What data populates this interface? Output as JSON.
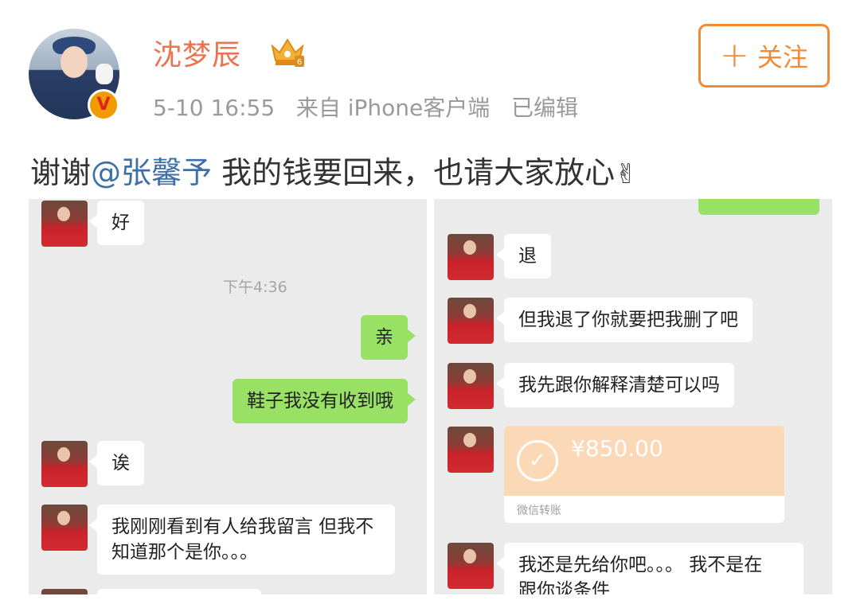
{
  "post": {
    "username": "沈梦辰",
    "date": "5-10 16:55",
    "source": "来自 iPhone客户端",
    "edited": "已编辑",
    "follow_label": "关注",
    "text_prefix": "谢谢",
    "mention": "@张馨予",
    "text_suffix": " 我的钱要回来，也请大家放心",
    "badge_icon": "verified-v-icon",
    "crown_icon": "crown-level-icon",
    "emoji_icon": "victory-hand-icon"
  },
  "chat_left": {
    "messages": [
      {
        "side": "in",
        "text": "好"
      },
      {
        "side": "time",
        "text": "下午4:36"
      },
      {
        "side": "out",
        "text": "亲"
      },
      {
        "side": "out",
        "text": "鞋子我没有收到哦"
      },
      {
        "side": "in",
        "text": "诶"
      },
      {
        "side": "in",
        "line1": "我刚刚看到有人给我留言 但我不",
        "line2": "知道那个是你。。。"
      }
    ]
  },
  "chat_right": {
    "messages": [
      {
        "side": "in",
        "text": "退"
      },
      {
        "side": "in",
        "text": "但我退了你就要把我删了吧"
      },
      {
        "side": "in",
        "text": "我先跟你解释清楚可以吗"
      },
      {
        "side": "in",
        "line1": "我还是先给你吧。。。 我不是在",
        "line2": "跟你谈条件"
      }
    ],
    "transfer": {
      "amount": "¥850.00",
      "label": "微信转账"
    }
  },
  "colors": {
    "username": "#eb7350",
    "follow": "#f28a36",
    "mention": "#3e6fa6",
    "bubble_out": "#98e165",
    "chat_bg": "#ebebeb"
  }
}
